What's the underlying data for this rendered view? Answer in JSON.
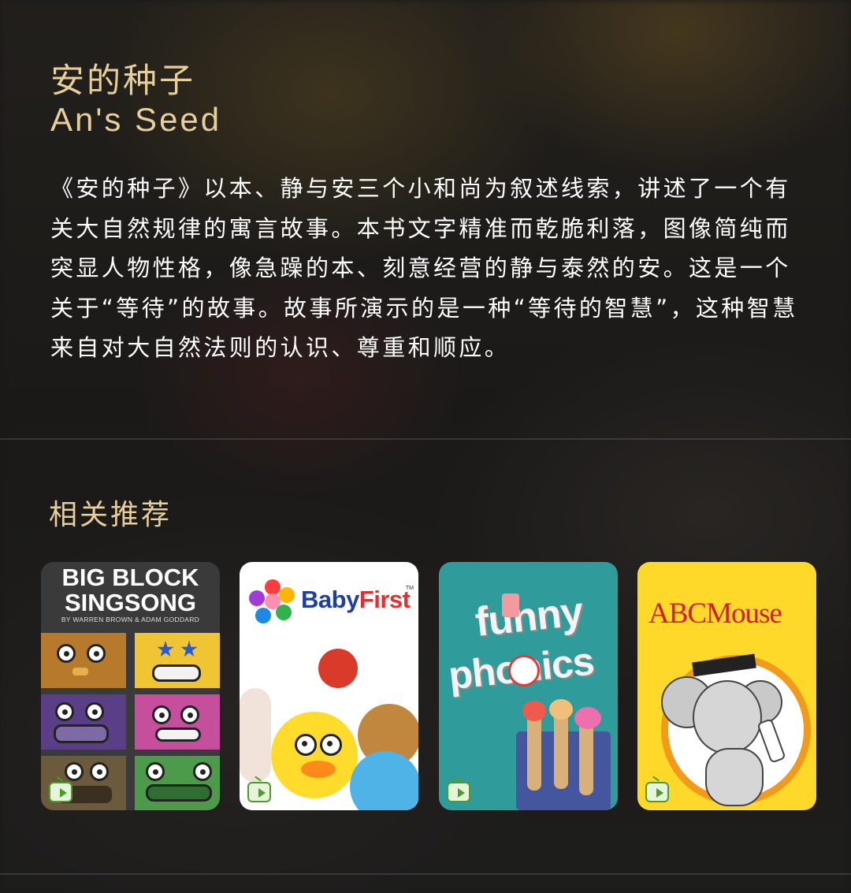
{
  "product": {
    "title_cn": "安的种子",
    "title_en": "An's Seed",
    "description": "《安的种子》以本、静与安三个小和尚为叙述线索，讲述了一个有关大自然规律的寓言故事。本书文字精准而乾脆利落，图像简纯而突显人物性格，像急躁的本、刻意经营的静与泰然的安。这是一个关于“等待”的故事。故事所演示的是一种“等待的智慧”，这种智慧来自对大自然法则的认识、尊重和顺应。"
  },
  "recommendations": {
    "title": "相关推荐",
    "items": [
      {
        "cover_line1": "BIG BLOCK",
        "cover_line2": "SINGSONG",
        "cover_credit": "BY WARREN BROWN & ADAM GODDARD",
        "badge_icon": "play-tv-icon"
      },
      {
        "cover_brand_a": "Baby",
        "cover_brand_b": "First",
        "cover_tm": "TM",
        "badge_icon": "play-tv-icon"
      },
      {
        "cover_line1": "funny",
        "cover_line2": "phonics",
        "badge_icon": "play-tv-icon"
      },
      {
        "cover_brand": "ABCMouse",
        "badge_icon": "play-tv-icon"
      }
    ]
  },
  "colors": {
    "accent_gold": "#e7cf9b",
    "text_white": "#ffffff"
  }
}
